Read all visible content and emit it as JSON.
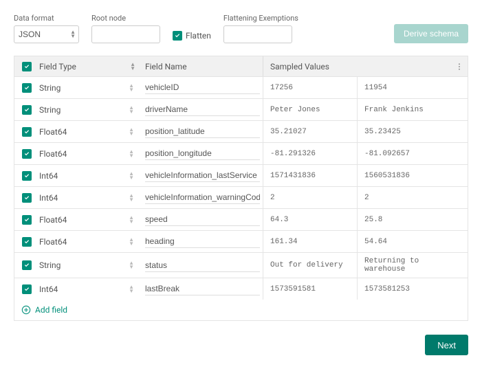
{
  "controls": {
    "dataFormatLabel": "Data format",
    "dataFormatValue": "JSON",
    "rootNodeLabel": "Root node",
    "rootNodeValue": "",
    "flattenLabel": "Flatten",
    "flattenExemptionsLabel": "Flattening Exemptions",
    "flattenExemptionsValue": "",
    "deriveSchemaLabel": "Derive schema"
  },
  "tableHeader": {
    "fieldType": "Field Type",
    "fieldName": "Field Name",
    "sampledValues": "Sampled Values"
  },
  "rows": [
    {
      "type": "String",
      "name": "vehicleID",
      "s1": "17256",
      "s2": "11954"
    },
    {
      "type": "String",
      "name": "driverName",
      "s1": "Peter Jones",
      "s2": "Frank Jenkins"
    },
    {
      "type": "Float64",
      "name": "position_latitude",
      "s1": "35.21027",
      "s2": "35.23425"
    },
    {
      "type": "Float64",
      "name": "position_longitude",
      "s1": "-81.291326",
      "s2": "-81.092657"
    },
    {
      "type": "Int64",
      "name": "vehicleInformation_lastService",
      "s1": "1571431836",
      "s2": "1560531836"
    },
    {
      "type": "Int64",
      "name": "vehicleInformation_warningCodes",
      "s1": "2",
      "s2": "2"
    },
    {
      "type": "Float64",
      "name": "speed",
      "s1": "64.3",
      "s2": "25.8"
    },
    {
      "type": "Float64",
      "name": "heading",
      "s1": "161.34",
      "s2": "54.64"
    },
    {
      "type": "String",
      "name": "status",
      "s1": "Out for delivery",
      "s2": "Returning to warehouse"
    },
    {
      "type": "Int64",
      "name": "lastBreak",
      "s1": "1573591581",
      "s2": "1573581253"
    }
  ],
  "addFieldLabel": "Add field",
  "footer": {
    "nextLabel": "Next"
  }
}
